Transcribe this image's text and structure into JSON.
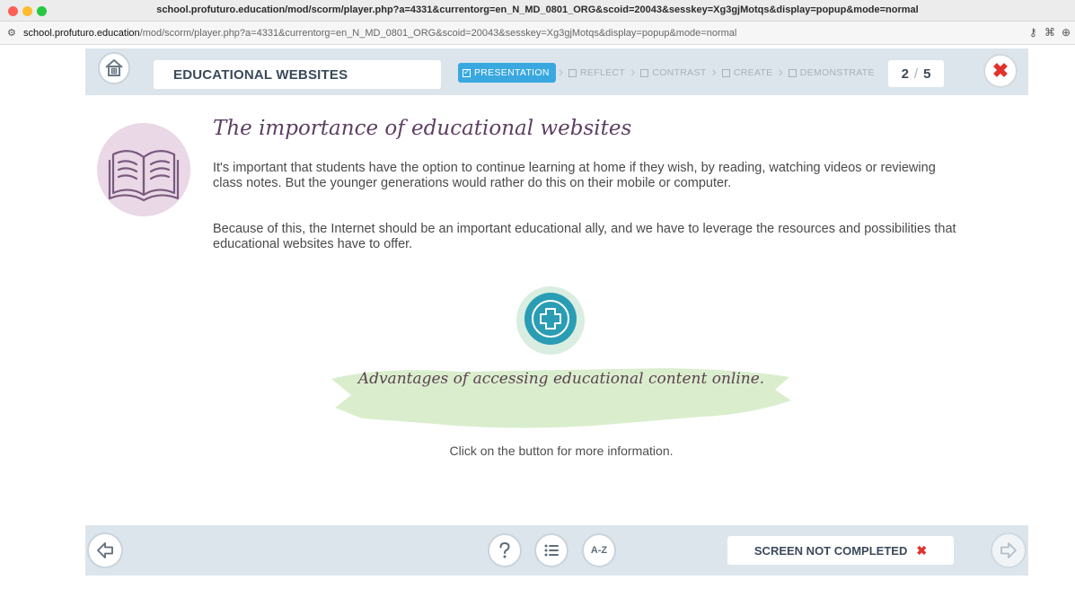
{
  "window": {
    "title": "school.profuturo.education/mod/scorm/player.php?a=4331&currentorg=en_N_MD_0801_ORG&scoid=20043&sesskey=Xg3gjMotqs&display=popup&mode=normal"
  },
  "address_bar": {
    "url_host": "school.profuturo.education",
    "url_path": "/mod/scorm/player.php?a=4331&currentorg=en_N_MD_0801_ORG&scoid=20043&sesskey=Xg3gjMotqs&display=popup&mode=normal",
    "icons": [
      "site-settings-icon",
      "key-icon",
      "translate-icon",
      "zoom-icon"
    ]
  },
  "header": {
    "course_title": "EDUCATIONAL WEBSITES",
    "steps": [
      {
        "label": "PRESENTATION",
        "active": true
      },
      {
        "label": "REFLECT",
        "active": false
      },
      {
        "label": "CONTRAST",
        "active": false
      },
      {
        "label": "CREATE",
        "active": false
      },
      {
        "label": "DEMONSTRATE",
        "active": false
      }
    ],
    "page_current": "2",
    "page_separator": "/",
    "page_total": "5"
  },
  "main": {
    "heading": "The importance of educational websites",
    "paragraph1": "It's important that students have the option to continue learning at home if they wish, by reading, watching videos or reviewing class notes. But the younger generations would rather do this on their mobile or computer.",
    "paragraph2": "Because of this, the Internet should be an important educational ally, and we have to leverage the resources and possibilities that educational websites have to offer.",
    "advantages_title": "Advantages of accessing educational content online.",
    "hint": "Click on the button for more information."
  },
  "footer": {
    "glossary_label": "A-Z",
    "status_label": "SCREEN NOT COMPLETED",
    "status_icon": "✖"
  },
  "colors": {
    "bar_bg": "#dde5ec",
    "active_step": "#3aa8e0",
    "heading": "#5d3e63",
    "close_red": "#e0322b",
    "plus_teal": "#2a9db5",
    "brush_green": "#d6ecc9",
    "book_circle": "#ead8e6"
  }
}
